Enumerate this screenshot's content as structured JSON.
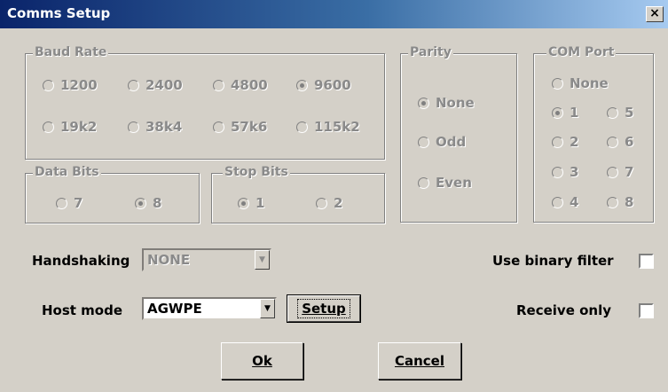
{
  "window": {
    "title": "Comms Setup",
    "close_label": "×"
  },
  "baud_rate": {
    "label": "Baud Rate",
    "options": [
      "1200",
      "2400",
      "4800",
      "9600",
      "19k2",
      "38k4",
      "57k6",
      "115k2"
    ],
    "selected": "9600"
  },
  "parity": {
    "label": "Parity",
    "options": [
      "None",
      "Odd",
      "Even"
    ],
    "selected": "None"
  },
  "com_port": {
    "label": "COM Port",
    "options": [
      "None",
      "1",
      "2",
      "3",
      "4",
      "5",
      "6",
      "7",
      "8"
    ],
    "selected": "1"
  },
  "data_bits": {
    "label": "Data Bits",
    "options": [
      "7",
      "8"
    ],
    "selected": "8"
  },
  "stop_bits": {
    "label": "Stop Bits",
    "options": [
      "1",
      "2"
    ],
    "selected": "1"
  },
  "handshaking": {
    "label": "Handshaking",
    "value": "NONE",
    "enabled": false
  },
  "host_mode": {
    "label": "Host mode",
    "value": "AGWPE",
    "setup_label": "Setup"
  },
  "use_binary_filter": {
    "label": "Use binary filter",
    "checked": false
  },
  "receive_only": {
    "label": "Receive only",
    "checked": false
  },
  "buttons": {
    "ok": "Ok",
    "cancel": "Cancel"
  },
  "icons": {
    "dropdown_arrow": "▼"
  }
}
